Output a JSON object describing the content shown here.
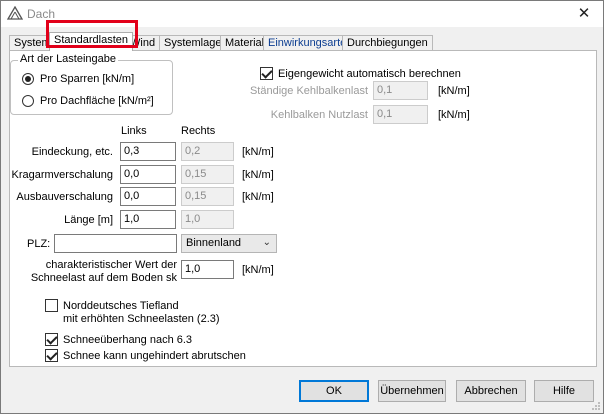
{
  "window": {
    "title": "Dach",
    "close_glyph": "✕"
  },
  "tabs": [
    "System",
    "Standardlasten",
    "Wind",
    "Systemlager",
    "Material",
    "Einwirkungsarten",
    "Durchbiegungen"
  ],
  "active_tab_index": 1,
  "highlight_color": "#e2001a",
  "load_input_group": {
    "label": "Art der Lasteingabe",
    "options": [
      "Pro Sparren [kN/m]",
      "Pro Dachfläche [kN/m²]"
    ],
    "selected_index": 0
  },
  "self_weight": {
    "label": "Eigengewicht automatisch berechnen",
    "checked": true,
    "rows": [
      {
        "label": "Ständige Kehlbalkenlast",
        "value": "0,1",
        "unit": "[kN/m]"
      },
      {
        "label": "Kehlbalken Nutzlast",
        "value": "0,1",
        "unit": "[kN/m]"
      }
    ]
  },
  "columns": {
    "left": "Links",
    "right": "Rechts"
  },
  "load_rows": [
    {
      "label": "Eindeckung, etc.",
      "left": "0,3",
      "right": "0,2",
      "unit": "[kN/m]"
    },
    {
      "label": "Kragarmverschalung",
      "left": "0,0",
      "right": "0,15",
      "unit": "[kN/m]"
    },
    {
      "label": "Ausbauverschalung",
      "left": "0,0",
      "right": "0,15",
      "unit": "[kN/m]"
    },
    {
      "label": "Länge [m]",
      "left": "1,0",
      "right": "1,0",
      "unit": ""
    }
  ],
  "plz": {
    "label": "PLZ:",
    "value": "",
    "region": "Binnenland"
  },
  "snow": {
    "label_line1": "charakteristischer Wert der",
    "label_line2": "Schneelast auf dem Boden sk",
    "value": "1,0",
    "unit": "[kN/m]"
  },
  "checks": [
    {
      "label_line1": "Norddeutsches Tiefland",
      "label_line2": "mit erhöhten Schneelasten (2.3)",
      "checked": false
    },
    {
      "label_line1": "Schneeüberhang nach 6.3",
      "label_line2": "",
      "checked": true
    },
    {
      "label_line1": "Schnee kann ungehindert abrutschen",
      "label_line2": "",
      "checked": true
    }
  ],
  "buttons": {
    "ok": "OK",
    "apply": "Übernehmen",
    "cancel": "Abbrechen",
    "help": "Hilfe"
  }
}
